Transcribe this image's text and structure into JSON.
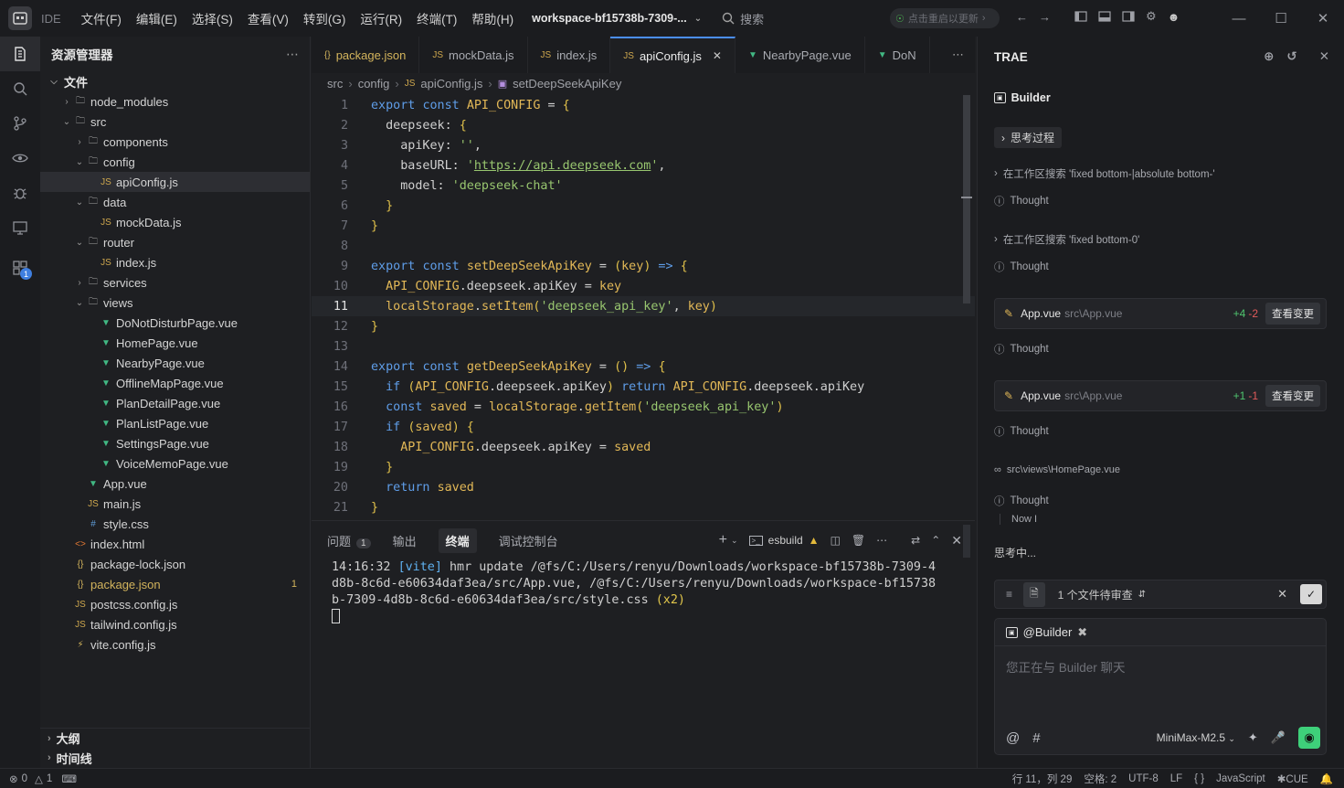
{
  "titlebar": {
    "ide_label": "IDE",
    "menu": [
      "文件(F)",
      "编辑(E)",
      "选择(S)",
      "查看(V)",
      "转到(G)",
      "运行(R)",
      "终端(T)",
      "帮助(H)"
    ],
    "workspace": "workspace-bf15738b-7309-...",
    "search": "搜索",
    "update_hint": "点击重启以更新"
  },
  "sidebar": {
    "title": "资源管理器",
    "root": "文件",
    "tree": [
      {
        "label": "node_modules",
        "kind": "folder",
        "depth": 1,
        "open": false
      },
      {
        "label": "src",
        "kind": "folder",
        "depth": 1,
        "open": true
      },
      {
        "label": "components",
        "kind": "folder",
        "depth": 2,
        "open": false
      },
      {
        "label": "config",
        "kind": "folder",
        "depth": 2,
        "open": true
      },
      {
        "label": "apiConfig.js",
        "kind": "js",
        "depth": 3,
        "selected": true
      },
      {
        "label": "data",
        "kind": "folder",
        "depth": 2,
        "open": true
      },
      {
        "label": "mockData.js",
        "kind": "js",
        "depth": 3
      },
      {
        "label": "router",
        "kind": "folder",
        "depth": 2,
        "open": true
      },
      {
        "label": "index.js",
        "kind": "js",
        "depth": 3
      },
      {
        "label": "services",
        "kind": "folder",
        "depth": 2,
        "open": false
      },
      {
        "label": "views",
        "kind": "folder",
        "depth": 2,
        "open": true
      },
      {
        "label": "DoNotDisturbPage.vue",
        "kind": "vue",
        "depth": 3
      },
      {
        "label": "HomePage.vue",
        "kind": "vue",
        "depth": 3
      },
      {
        "label": "NearbyPage.vue",
        "kind": "vue",
        "depth": 3
      },
      {
        "label": "OfflineMapPage.vue",
        "kind": "vue",
        "depth": 3
      },
      {
        "label": "PlanDetailPage.vue",
        "kind": "vue",
        "depth": 3
      },
      {
        "label": "PlanListPage.vue",
        "kind": "vue",
        "depth": 3
      },
      {
        "label": "SettingsPage.vue",
        "kind": "vue",
        "depth": 3
      },
      {
        "label": "VoiceMemoPage.vue",
        "kind": "vue",
        "depth": 3
      },
      {
        "label": "App.vue",
        "kind": "vue",
        "depth": 2
      },
      {
        "label": "main.js",
        "kind": "js",
        "depth": 2
      },
      {
        "label": "style.css",
        "kind": "css",
        "depth": 2
      },
      {
        "label": "index.html",
        "kind": "html",
        "depth": 1
      },
      {
        "label": "package-lock.json",
        "kind": "json",
        "depth": 1
      },
      {
        "label": "package.json",
        "kind": "json",
        "depth": 1,
        "modified": "1"
      },
      {
        "label": "postcss.config.js",
        "kind": "js",
        "depth": 1
      },
      {
        "label": "tailwind.config.js",
        "kind": "js",
        "depth": 1
      },
      {
        "label": "vite.config.js",
        "kind": "vite",
        "depth": 1
      }
    ],
    "outline": "大纲",
    "timeline": "时间线"
  },
  "tabs": [
    {
      "label": "package.json",
      "kind": "json",
      "active": false
    },
    {
      "label": "mockData.js",
      "kind": "js",
      "active": false
    },
    {
      "label": "index.js",
      "kind": "js",
      "active": false
    },
    {
      "label": "apiConfig.js",
      "kind": "js",
      "active": true
    },
    {
      "label": "NearbyPage.vue",
      "kind": "vue",
      "active": false
    },
    {
      "label": "DoN",
      "kind": "vue",
      "active": false
    }
  ],
  "breadcrumb": [
    "src",
    "config",
    "apiConfig.js",
    "setDeepSeekApiKey"
  ],
  "code": {
    "current_line": 11,
    "lines": [
      [
        [
          "k",
          "export "
        ],
        [
          "k",
          "const "
        ],
        [
          "v",
          "API_CONFIG"
        ],
        [
          "p",
          " = "
        ],
        [
          "b",
          "{"
        ]
      ],
      [
        [
          "p",
          "  deepseek: "
        ],
        [
          "b",
          "{"
        ]
      ],
      [
        [
          "p",
          "    apiKey: "
        ],
        [
          "s",
          "''"
        ],
        [
          "p",
          ","
        ]
      ],
      [
        [
          "p",
          "    baseURL: "
        ],
        [
          "s",
          "'"
        ],
        [
          "url",
          "https://api.deepseek.com"
        ],
        [
          "s",
          "'"
        ],
        [
          "p",
          ","
        ]
      ],
      [
        [
          "p",
          "    model: "
        ],
        [
          "s",
          "'deepseek-chat'"
        ]
      ],
      [
        [
          "b",
          "  }"
        ]
      ],
      [
        [
          "b",
          "}"
        ]
      ],
      [],
      [
        [
          "k",
          "export "
        ],
        [
          "k",
          "const "
        ],
        [
          "fn",
          "setDeepSeekApiKey"
        ],
        [
          "p",
          " = "
        ],
        [
          "b",
          "("
        ],
        [
          "v",
          "key"
        ],
        [
          "b",
          ")"
        ],
        [
          "k",
          " => "
        ],
        [
          "b",
          "{"
        ]
      ],
      [
        [
          "v",
          "  API_CONFIG"
        ],
        [
          "p",
          ".deepseek.apiKey = "
        ],
        [
          "v",
          "key"
        ]
      ],
      [
        [
          "v",
          "  localStorage"
        ],
        [
          "p",
          "."
        ],
        [
          "fn",
          "setItem"
        ],
        [
          "b",
          "("
        ],
        [
          "s",
          "'deepseek_api_key'"
        ],
        [
          "p",
          ", "
        ],
        [
          "v",
          "key"
        ],
        [
          "b",
          ")"
        ]
      ],
      [
        [
          "b",
          "}"
        ]
      ],
      [],
      [
        [
          "k",
          "export "
        ],
        [
          "k",
          "const "
        ],
        [
          "fn",
          "getDeepSeekApiKey"
        ],
        [
          "p",
          " = "
        ],
        [
          "b",
          "()"
        ],
        [
          "k",
          " => "
        ],
        [
          "b",
          "{"
        ]
      ],
      [
        [
          "k",
          "  if "
        ],
        [
          "b",
          "("
        ],
        [
          "v",
          "API_CONFIG"
        ],
        [
          "p",
          ".deepseek.apiKey"
        ],
        [
          "b",
          ")"
        ],
        [
          "k",
          " return "
        ],
        [
          "v",
          "API_CONFIG"
        ],
        [
          "p",
          ".deepseek.apiKey"
        ]
      ],
      [
        [
          "k",
          "  const "
        ],
        [
          "v",
          "saved"
        ],
        [
          "p",
          " = "
        ],
        [
          "v",
          "localStorage"
        ],
        [
          "p",
          "."
        ],
        [
          "fn",
          "getItem"
        ],
        [
          "b",
          "("
        ],
        [
          "s",
          "'deepseek_api_key'"
        ],
        [
          "b",
          ")"
        ]
      ],
      [
        [
          "k",
          "  if "
        ],
        [
          "b",
          "("
        ],
        [
          "v",
          "saved"
        ],
        [
          "b",
          ") {"
        ]
      ],
      [
        [
          "v",
          "    API_CONFIG"
        ],
        [
          "p",
          ".deepseek.apiKey = "
        ],
        [
          "v",
          "saved"
        ]
      ],
      [
        [
          "b",
          "  }"
        ]
      ],
      [
        [
          "k",
          "  return "
        ],
        [
          "v",
          "saved"
        ]
      ],
      [
        [
          "b",
          "}"
        ]
      ]
    ]
  },
  "panel": {
    "tabs": [
      {
        "label": "问题",
        "count": "1",
        "active": false
      },
      {
        "label": "输出",
        "active": false
      },
      {
        "label": "终端",
        "active": true
      },
      {
        "label": "调试控制台",
        "active": false
      }
    ],
    "task": "esbuild",
    "terminal": {
      "time": "14:16:32",
      "tag": "[vite]",
      "msg": " hmr update /@fs/C:/Users/renyu/Downloads/workspace-bf15738b-7309-4d8b-8c6d-e60634daf3ea/src/App.vue, /@fs/C:/Users/renyu/Downloads/workspace-bf15738b-7309-4d8b-8c6d-e60634daf3ea/src/style.css ",
      "count": "(x2)"
    }
  },
  "trae": {
    "title": "TRAE",
    "agent": "Builder",
    "thinking_chip": "思考过程",
    "search1": "在工作区搜索 'fixed bottom-|absolute bottom-'",
    "search2": "在工作区搜索 'fixed bottom-0'",
    "thought": "Thought",
    "card1": {
      "name": "App.vue",
      "path": "src\\App.vue",
      "plus": "+4",
      "minus": "-2",
      "btn": "查看变更"
    },
    "card2": {
      "name": "App.vue",
      "path": "src\\App.vue",
      "plus": "+1",
      "minus": "-1",
      "btn": "查看变更"
    },
    "viewed": "src\\views\\HomePage.vue",
    "now": "Now I",
    "thinking": "思考中...",
    "review": "1 个文件待审查",
    "mention": "@Builder",
    "placeholder": "您正在与 Builder 聊天",
    "model": "MiniMax-M2.5"
  },
  "statusbar": {
    "errors": "0",
    "warnings": "1",
    "position": "行 11，列 29",
    "spaces": "空格: 2",
    "encoding": "UTF-8",
    "eol": "LF",
    "braces": "{ }",
    "language": "JavaScript",
    "cue": "CUE"
  }
}
